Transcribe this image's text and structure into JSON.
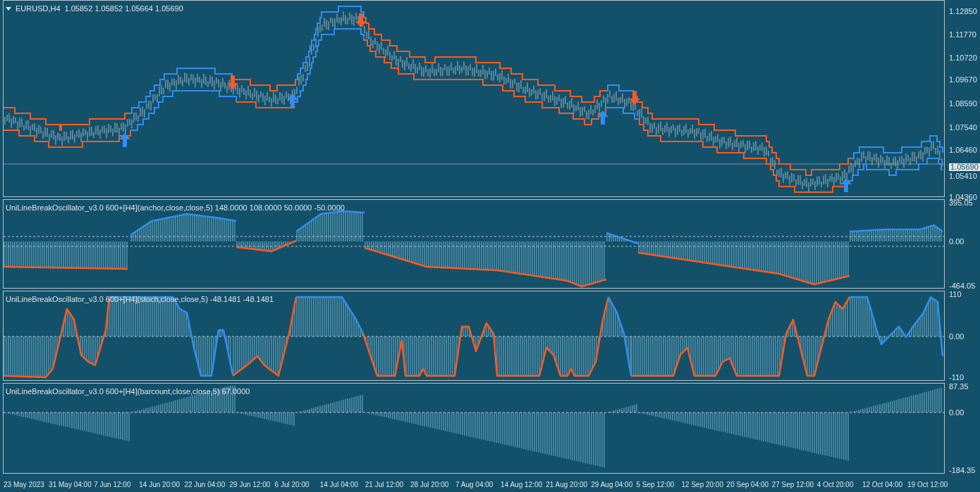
{
  "chart": {
    "symbol": "EURUSD,H4",
    "ohlc": "1.05852 1.05852 1.05664 1.05690",
    "price_axis": [
      "1.12850",
      "1.11770",
      "1.10720",
      "1.09670",
      "1.08590",
      "1.07540",
      "1.06460",
      "1.05410",
      "1.04360"
    ],
    "current_price": "1.05690"
  },
  "indicators": [
    {
      "label": "UniLineBreakOscillator_v3.0 600+[H4](anchor,close,close,5) 148.0000 108.0000 50.0000 -50.0000",
      "axis": [
        "395.05",
        "0.00",
        "-464.05"
      ]
    },
    {
      "label": "UniLineBreakOscillator_v3.0 600+[H4](stoch,close,close,5) -48.1481 -48.1481",
      "axis": [
        "110",
        "0.00",
        "-110"
      ]
    },
    {
      "label": "UniLineBreakOscillator_v3.0 600+[H4](barcount,close,close,5) 67.0000",
      "axis": [
        "87.35",
        "0.00",
        "-184.35"
      ]
    }
  ],
  "time_axis": [
    "23 May 2023",
    "31 May 04:00",
    "7 Jun 12:00",
    "14 Jun 20:00",
    "22 Jun 04:00",
    "29 Jun 12:00",
    "6 Jul 20:00",
    "14 Jul 04:00",
    "21 Jul 12:00",
    "28 Jul 20:00",
    "7 Aug 04:00",
    "14 Aug 12:00",
    "21 Aug 20:00",
    "29 Aug 04:00",
    "5 Sep 12:00",
    "12 Sep 20:00",
    "20 Sep 04:00",
    "27 Sep 12:00",
    "4 Oct 20:00",
    "12 Oct 04:00",
    "19 Oct 12:00"
  ]
}
